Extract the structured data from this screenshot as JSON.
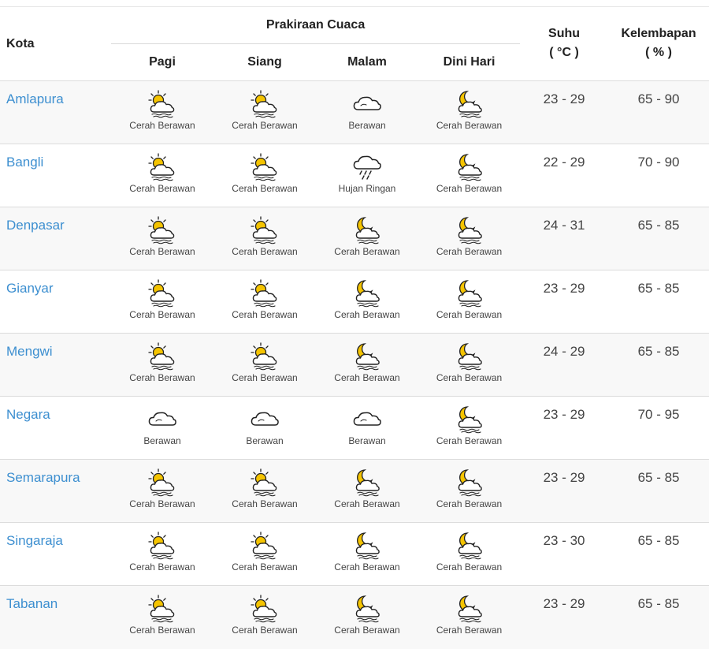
{
  "header": {
    "kota": "Kota",
    "forecast_group": "Prakiraan Cuaca",
    "periods": [
      "Pagi",
      "Siang",
      "Malam",
      "Dini Hari"
    ],
    "suhu": "Suhu",
    "suhu_unit": "( °C )",
    "kelembapan": "Kelembapan",
    "kelembapan_unit": "( % )"
  },
  "rows": [
    {
      "city": "Amlapura",
      "forecast": [
        {
          "icon": "partly-cloudy-sun",
          "label": "Cerah Berawan"
        },
        {
          "icon": "partly-cloudy-sun",
          "label": "Cerah Berawan"
        },
        {
          "icon": "cloud",
          "label": "Berawan"
        },
        {
          "icon": "partly-cloudy-moon",
          "label": "Cerah Berawan"
        }
      ],
      "suhu": "23 - 29",
      "kelembapan": "65 - 90"
    },
    {
      "city": "Bangli",
      "forecast": [
        {
          "icon": "partly-cloudy-sun",
          "label": "Cerah Berawan"
        },
        {
          "icon": "partly-cloudy-sun",
          "label": "Cerah Berawan"
        },
        {
          "icon": "light-rain",
          "label": "Hujan Ringan"
        },
        {
          "icon": "partly-cloudy-moon",
          "label": "Cerah Berawan"
        }
      ],
      "suhu": "22 - 29",
      "kelembapan": "70 - 90"
    },
    {
      "city": "Denpasar",
      "forecast": [
        {
          "icon": "partly-cloudy-sun",
          "label": "Cerah Berawan"
        },
        {
          "icon": "partly-cloudy-sun",
          "label": "Cerah Berawan"
        },
        {
          "icon": "partly-cloudy-moon",
          "label": "Cerah Berawan"
        },
        {
          "icon": "partly-cloudy-moon",
          "label": "Cerah Berawan"
        }
      ],
      "suhu": "24 - 31",
      "kelembapan": "65 - 85"
    },
    {
      "city": "Gianyar",
      "forecast": [
        {
          "icon": "partly-cloudy-sun",
          "label": "Cerah Berawan"
        },
        {
          "icon": "partly-cloudy-sun",
          "label": "Cerah Berawan"
        },
        {
          "icon": "partly-cloudy-moon",
          "label": "Cerah Berawan"
        },
        {
          "icon": "partly-cloudy-moon",
          "label": "Cerah Berawan"
        }
      ],
      "suhu": "23 - 29",
      "kelembapan": "65 - 85"
    },
    {
      "city": "Mengwi",
      "forecast": [
        {
          "icon": "partly-cloudy-sun",
          "label": "Cerah Berawan"
        },
        {
          "icon": "partly-cloudy-sun",
          "label": "Cerah Berawan"
        },
        {
          "icon": "partly-cloudy-moon",
          "label": "Cerah Berawan"
        },
        {
          "icon": "partly-cloudy-moon",
          "label": "Cerah Berawan"
        }
      ],
      "suhu": "24 - 29",
      "kelembapan": "65 - 85"
    },
    {
      "city": "Negara",
      "forecast": [
        {
          "icon": "cloud",
          "label": "Berawan"
        },
        {
          "icon": "cloud",
          "label": "Berawan"
        },
        {
          "icon": "cloud",
          "label": "Berawan"
        },
        {
          "icon": "partly-cloudy-moon",
          "label": "Cerah Berawan"
        }
      ],
      "suhu": "23 - 29",
      "kelembapan": "70 - 95"
    },
    {
      "city": "Semarapura",
      "forecast": [
        {
          "icon": "partly-cloudy-sun",
          "label": "Cerah Berawan"
        },
        {
          "icon": "partly-cloudy-sun",
          "label": "Cerah Berawan"
        },
        {
          "icon": "partly-cloudy-moon",
          "label": "Cerah Berawan"
        },
        {
          "icon": "partly-cloudy-moon",
          "label": "Cerah Berawan"
        }
      ],
      "suhu": "23 - 29",
      "kelembapan": "65 - 85"
    },
    {
      "city": "Singaraja",
      "forecast": [
        {
          "icon": "partly-cloudy-sun",
          "label": "Cerah Berawan"
        },
        {
          "icon": "partly-cloudy-sun",
          "label": "Cerah Berawan"
        },
        {
          "icon": "partly-cloudy-moon",
          "label": "Cerah Berawan"
        },
        {
          "icon": "partly-cloudy-moon",
          "label": "Cerah Berawan"
        }
      ],
      "suhu": "23 - 30",
      "kelembapan": "65 - 85"
    },
    {
      "city": "Tabanan",
      "forecast": [
        {
          "icon": "partly-cloudy-sun",
          "label": "Cerah Berawan"
        },
        {
          "icon": "partly-cloudy-sun",
          "label": "Cerah Berawan"
        },
        {
          "icon": "partly-cloudy-moon",
          "label": "Cerah Berawan"
        },
        {
          "icon": "partly-cloudy-moon",
          "label": "Cerah Berawan"
        }
      ],
      "suhu": "23 - 29",
      "kelembapan": "65 - 85"
    }
  ],
  "colors": {
    "city_link": "#3d8fd0",
    "sun_moon_fill": "#f5c400",
    "row_alt": "#f8f8f8",
    "border": "#dcdcdc"
  }
}
